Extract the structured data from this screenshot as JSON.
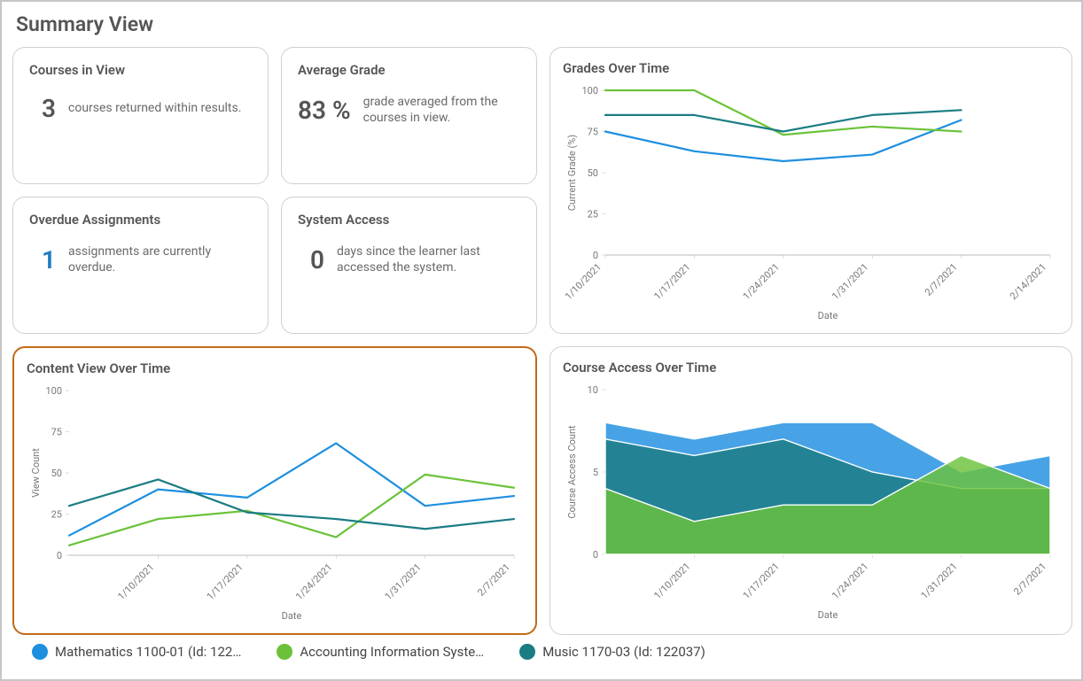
{
  "title": "Summary View",
  "cards": {
    "courses": {
      "title": "Courses in View",
      "value": "3",
      "desc": "courses returned within results."
    },
    "avg_grade": {
      "title": "Average Grade",
      "value": "83 %",
      "desc": "grade averaged from the courses in view."
    },
    "overdue": {
      "title": "Overdue Assignments",
      "value": "1",
      "desc": "assignments are currently overdue."
    },
    "access": {
      "title": "System Access",
      "value": "0",
      "desc": "days since the learner last accessed the system."
    }
  },
  "legend": [
    {
      "label": "Mathematics 1100-01 (Id: 122…",
      "color": "#1e8fe0"
    },
    {
      "label": "Accounting Information Syste…",
      "color": "#6bc23a"
    },
    {
      "label": "Music 1170-03 (Id: 122037)",
      "color": "#1b7d83"
    }
  ],
  "charts": {
    "grades": {
      "title": "Grades Over Time",
      "xlabel": "Date",
      "ylabel": "Current Grade (%)"
    },
    "content": {
      "title": "Content View Over Time",
      "xlabel": "Date",
      "ylabel": "View Count"
    },
    "course_access": {
      "title": "Course Access Over Time",
      "xlabel": "Date",
      "ylabel": "Course Access Count"
    }
  },
  "chart_data": [
    {
      "id": "grades",
      "type": "line",
      "title": "Grades Over Time",
      "xlabel": "Date",
      "ylabel": "Current Grade (%)",
      "categories": [
        "1/10/2021",
        "1/17/2021",
        "1/24/2021",
        "1/31/2021",
        "2/7/2021",
        "2/14/2021"
      ],
      "ylim": [
        0,
        100
      ],
      "yticks": [
        0,
        25,
        50,
        75,
        100
      ],
      "series": [
        {
          "name": "Mathematics 1100-01",
          "color": "#1e8fe0",
          "values": [
            75,
            63,
            57,
            61,
            82,
            null
          ]
        },
        {
          "name": "Accounting Information Systems",
          "color": "#6bc23a",
          "values": [
            100,
            100,
            73,
            78,
            75,
            null
          ]
        },
        {
          "name": "Music 1170-03",
          "color": "#1b7d83",
          "values": [
            85,
            85,
            75,
            85,
            88,
            null
          ]
        }
      ]
    },
    {
      "id": "content",
      "type": "line",
      "title": "Content View Over Time",
      "xlabel": "Date",
      "ylabel": "View Count",
      "categories": [
        "1/10/2021",
        "1/17/2021",
        "1/24/2021",
        "1/31/2021",
        "2/7/2021"
      ],
      "ylim": [
        0,
        100
      ],
      "yticks": [
        0,
        25,
        50,
        75,
        100
      ],
      "series": [
        {
          "name": "Mathematics 1100-01",
          "color": "#1e8fe0",
          "values": [
            12,
            40,
            35,
            68,
            30,
            36
          ]
        },
        {
          "name": "Accounting Information Systems",
          "color": "#6bc23a",
          "values": [
            6,
            22,
            27,
            11,
            49,
            41
          ]
        },
        {
          "name": "Music 1170-03",
          "color": "#1b7d83",
          "values": [
            30,
            46,
            26,
            22,
            16,
            22
          ]
        }
      ],
      "note_x": [
        "left-edge",
        "1/10/2021",
        "1/17/2021",
        "1/24/2021",
        "1/31/2021",
        "2/7/2021"
      ]
    },
    {
      "id": "course_access",
      "type": "area",
      "title": "Course Access Over Time",
      "xlabel": "Date",
      "ylabel": "Course Access Count",
      "categories": [
        "1/10/2021",
        "1/17/2021",
        "1/24/2021",
        "1/31/2021",
        "2/7/2021"
      ],
      "ylim": [
        0,
        10
      ],
      "yticks": [
        0,
        5,
        10
      ],
      "series": [
        {
          "name": "Mathematics 1100-01",
          "color": "#1e8fe0",
          "values": [
            8,
            7,
            8,
            8,
            5,
            6
          ]
        },
        {
          "name": "Accounting Information Systems",
          "color": "#6bc23a",
          "values": [
            4,
            2,
            3,
            3,
            6,
            4
          ]
        },
        {
          "name": "Music 1170-03",
          "color": "#1b7d83",
          "values": [
            7,
            6,
            7,
            5,
            4,
            4
          ]
        }
      ],
      "note_x": [
        "left-edge",
        "1/10/2021",
        "1/17/2021",
        "1/24/2021",
        "1/31/2021",
        "2/7/2021"
      ]
    }
  ]
}
